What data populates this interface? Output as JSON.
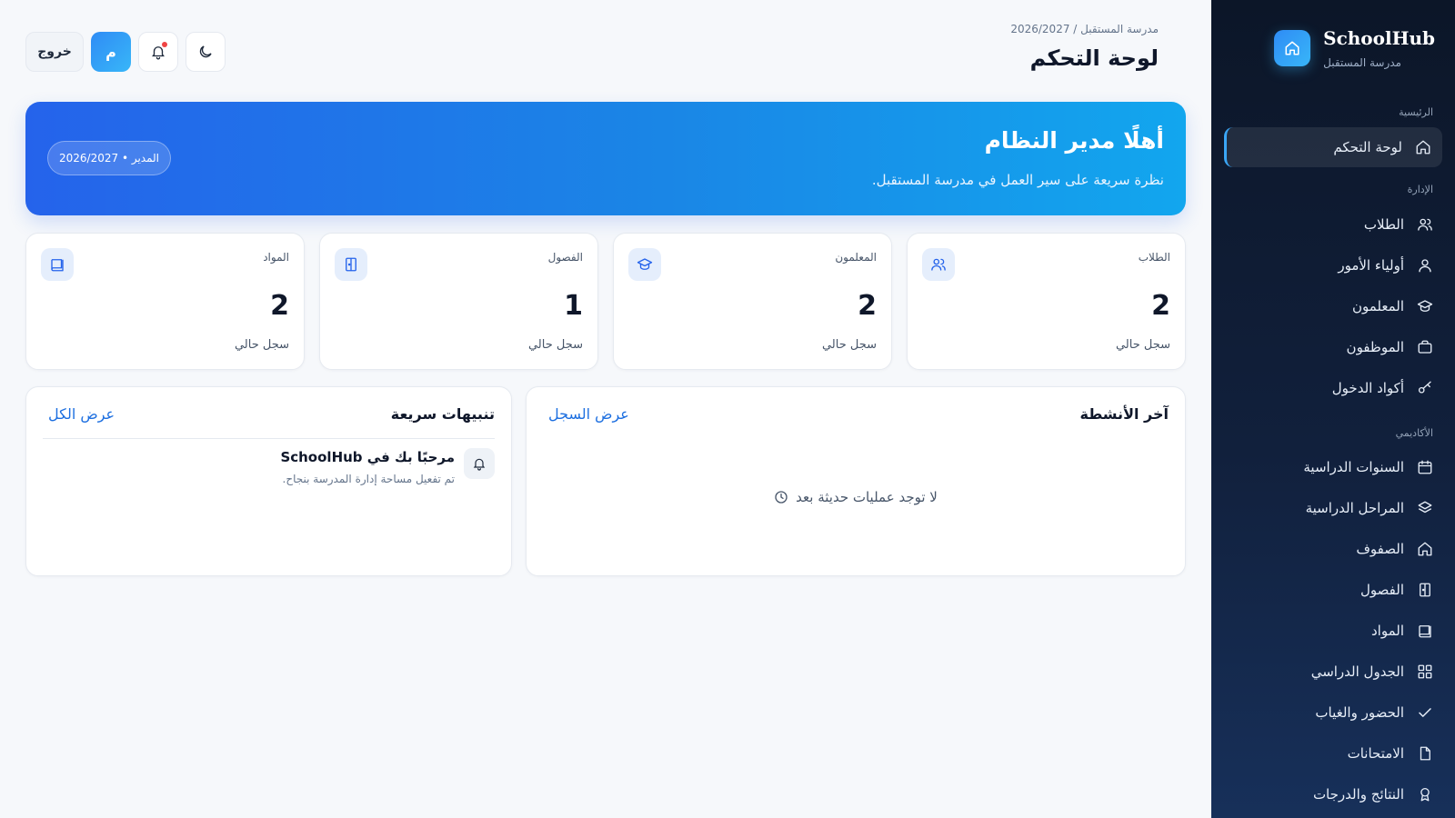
{
  "brand": {
    "name": "SchoolHub",
    "school": "مدرسة المستقبل"
  },
  "sidebar": {
    "sections": {
      "main": "الرئيسية",
      "admin": "الإدارة",
      "academic": "الأكاديمي"
    },
    "items": [
      {
        "label": "لوحة التحكم",
        "icon": "home-icon"
      },
      {
        "label": "الطلاب",
        "icon": "users-icon"
      },
      {
        "label": "أولياء الأمور",
        "icon": "user-icon"
      },
      {
        "label": "المعلمون",
        "icon": "graduation-cap-icon"
      },
      {
        "label": "الموظفون",
        "icon": "briefcase-icon"
      },
      {
        "label": "أكواد الدخول",
        "icon": "key-icon"
      },
      {
        "label": "السنوات الدراسية",
        "icon": "calendar-icon"
      },
      {
        "label": "المراحل الدراسية",
        "icon": "layers-icon"
      },
      {
        "label": "الصفوف",
        "icon": "home-icon"
      },
      {
        "label": "الفصول",
        "icon": "door-icon"
      },
      {
        "label": "المواد",
        "icon": "book-icon"
      },
      {
        "label": "الجدول الدراسي",
        "icon": "grid-icon"
      },
      {
        "label": "الحضور والغياب",
        "icon": "check-icon"
      },
      {
        "label": "الامتحانات",
        "icon": "file-icon"
      },
      {
        "label": "النتائج والدرجات",
        "icon": "award-icon"
      }
    ]
  },
  "header": {
    "breadcrumb": "مدرسة المستقبل / 2026/2027",
    "title": "لوحة التحكم",
    "logout": "خروج",
    "avatar_initial": "م"
  },
  "hero": {
    "title": "أهلًا مدير النظام",
    "subtitle": "نظرة سريعة على سير العمل في مدرسة المستقبل.",
    "pill": "المدير • 2026/2027"
  },
  "stats": [
    {
      "label": "الطلاب",
      "value": "2",
      "sub": "سجل حالي",
      "icon": "users-icon"
    },
    {
      "label": "المعلمون",
      "value": "2",
      "sub": "سجل حالي",
      "icon": "graduation-cap-icon"
    },
    {
      "label": "الفصول",
      "value": "1",
      "sub": "سجل حالي",
      "icon": "door-icon"
    },
    {
      "label": "المواد",
      "value": "2",
      "sub": "سجل حالي",
      "icon": "book-icon"
    }
  ],
  "activities": {
    "title": "آخر الأنشطة",
    "link": "عرض السجل",
    "empty": "لا توجد عمليات حديثة بعد"
  },
  "alerts": {
    "title": "تنبيهات سريعة",
    "link": "عرض الكل",
    "items": [
      {
        "title": "مرحبًا بك في SchoolHub",
        "desc": "تم تفعيل مساحة إدارة المدرسة بنجاح."
      }
    ]
  },
  "colors": {
    "accent": "#2563eb",
    "sidebar_bg": "#0c1628",
    "notification_dot": "#ef4444"
  }
}
